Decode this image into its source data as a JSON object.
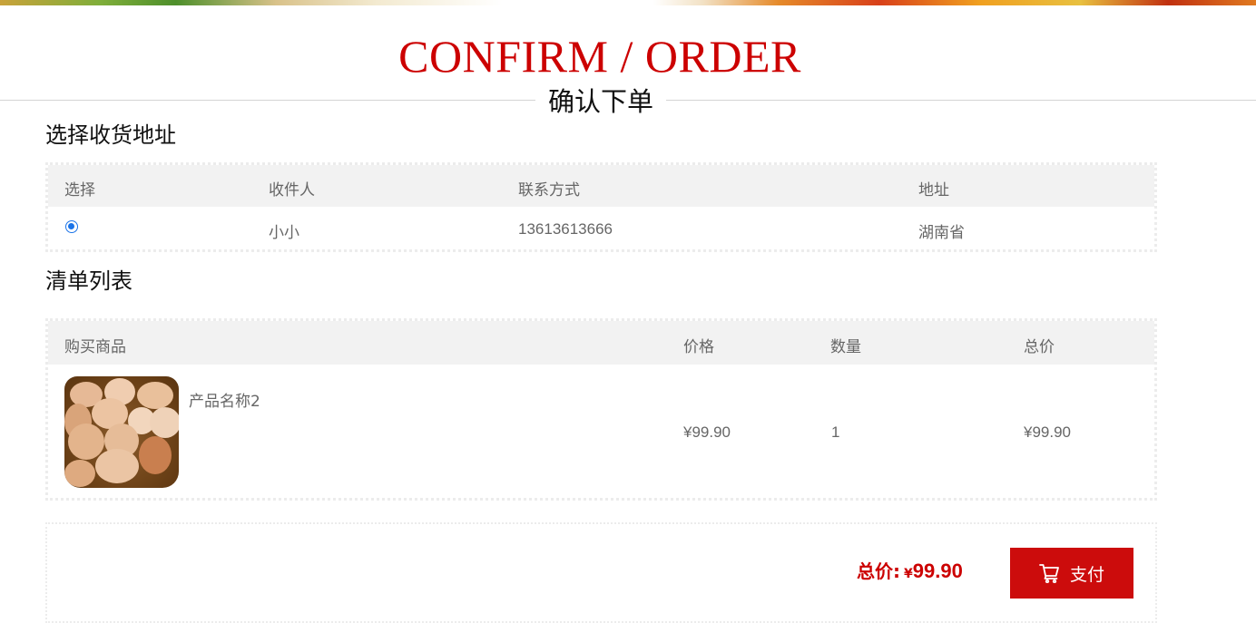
{
  "page": {
    "title_en": "CONFIRM / ORDER",
    "title_cn": "确认下单"
  },
  "address_section": {
    "title": "选择收货地址",
    "columns": [
      "选择",
      "收件人",
      "联系方式",
      "地址"
    ],
    "rows": [
      {
        "selected": true,
        "recipient": "小小",
        "phone": "13613613666",
        "address": "湖南省"
      }
    ]
  },
  "order_section": {
    "title": "清单列表",
    "columns": [
      "购买商品",
      "价格",
      "数量",
      "总价"
    ],
    "items": [
      {
        "image": "eggs-in-basket-photo",
        "name": "产品名称2",
        "price": "¥99.90",
        "quantity": "1",
        "subtotal": "¥99.90"
      }
    ]
  },
  "summary": {
    "total_label": "总价:",
    "currency": "¥",
    "total_amount": "99.90",
    "pay_button_label": "支付",
    "pay_icon": "cart-icon"
  },
  "colors": {
    "accent": "#cc0c0c",
    "title_red": "#cc0000",
    "radio_blue": "#1a73e8"
  }
}
